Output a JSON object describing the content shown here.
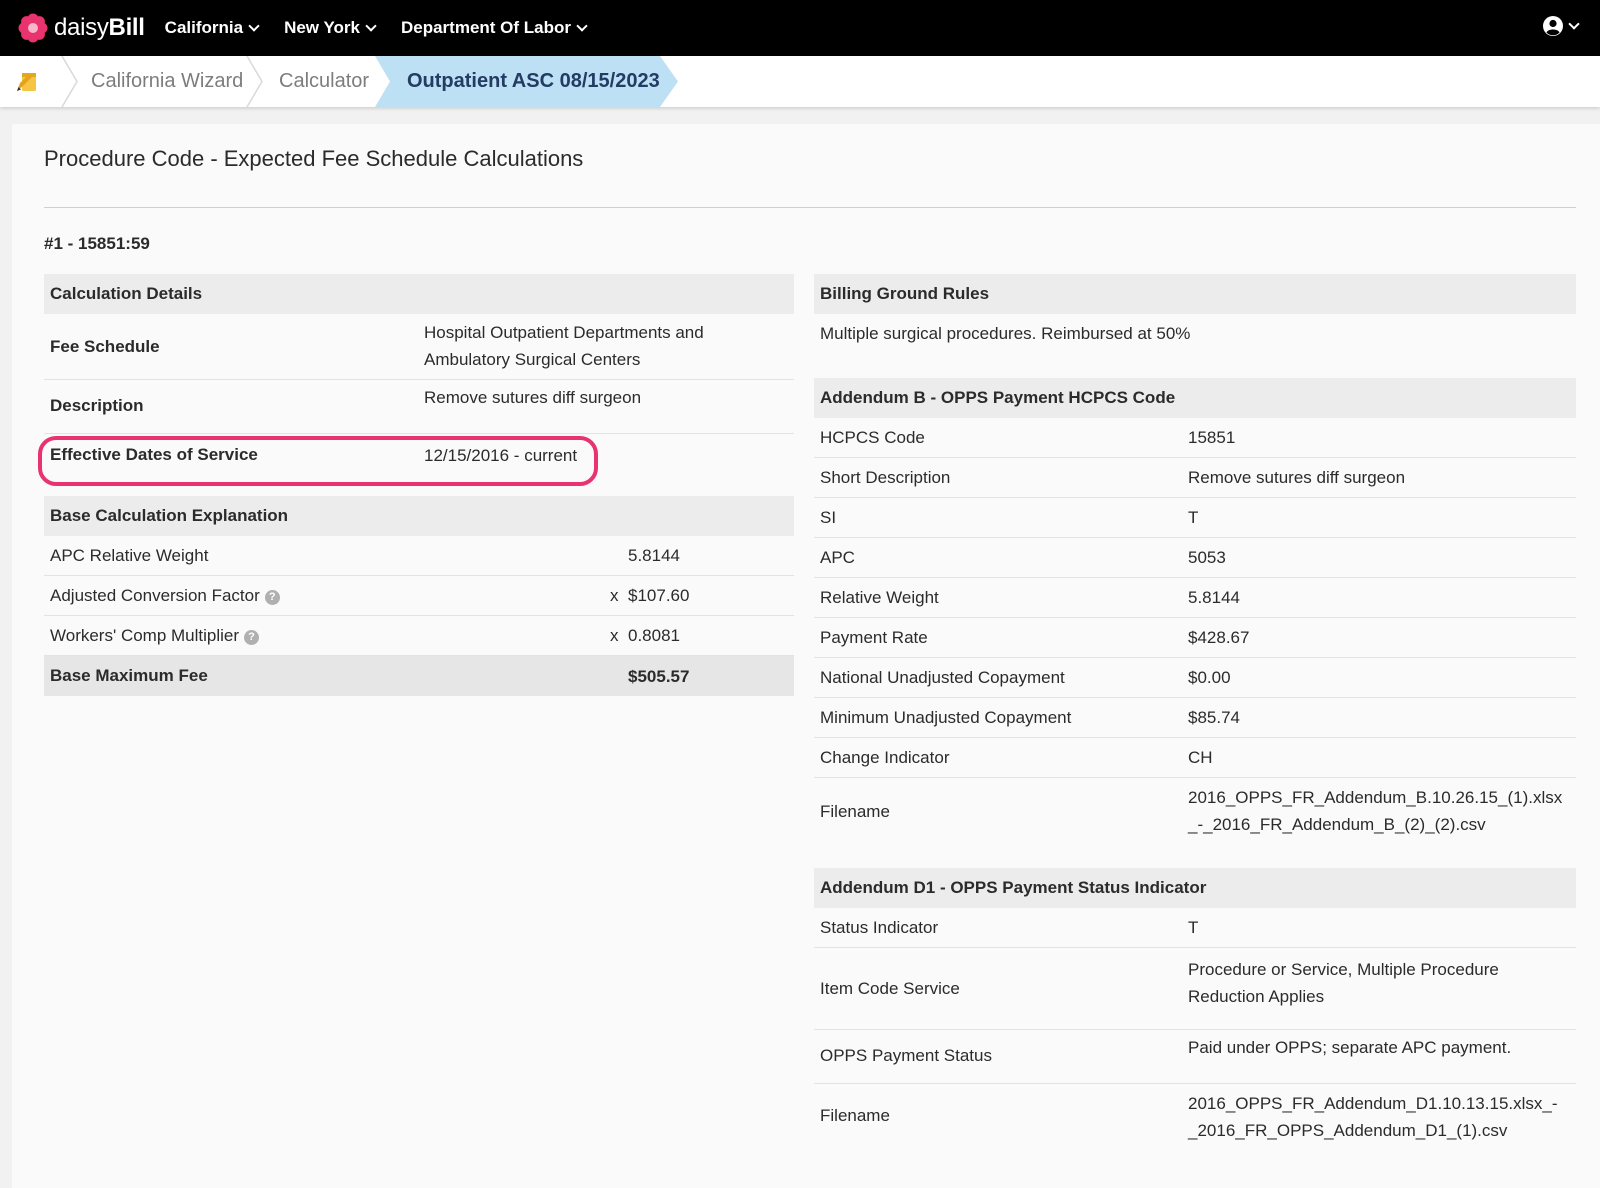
{
  "nav": {
    "brand_light": "daisy",
    "brand_bold": "Bill",
    "links": [
      "California",
      "New York",
      "Department Of Labor"
    ]
  },
  "breadcrumb": {
    "items": [
      "California Wizard",
      "Calculator"
    ],
    "active": "Outpatient ASC 08/15/2023"
  },
  "page": {
    "title": "Procedure Code - Expected Fee Schedule Calculations",
    "code_label": "#1 - 15851:59"
  },
  "calc_details": {
    "header": "Calculation Details",
    "fee_schedule_label": "Fee Schedule",
    "fee_schedule_value_1": "Hospital Outpatient Departments and",
    "fee_schedule_value_2": "Ambulatory Surgical Centers",
    "description_label": "Description",
    "description_value": "Remove sutures diff surgeon",
    "dates_label": "Effective Dates of Service",
    "dates_value": "12/15/2016 - current"
  },
  "base_calc": {
    "header": "Base Calculation Explanation",
    "apc_label": "APC Relative Weight",
    "apc_value": "5.8144",
    "acf_label": "Adjusted Conversion Factor",
    "acf_op": "x",
    "acf_value": "$107.60",
    "wcm_label": "Workers' Comp Multiplier",
    "wcm_op": "x",
    "wcm_value": "0.8081",
    "total_label": "Base Maximum Fee",
    "total_value": "$505.57"
  },
  "ground_rules": {
    "header": "Billing Ground Rules",
    "text": "Multiple surgical procedures. Reimbursed at 50%"
  },
  "addendum_b": {
    "header": "Addendum B - OPPS Payment HCPCS Code",
    "rows": [
      {
        "label": "HCPCS Code",
        "value": "15851"
      },
      {
        "label": "Short Description",
        "value": "Remove sutures diff surgeon"
      },
      {
        "label": "SI",
        "value": "T"
      },
      {
        "label": "APC",
        "value": "5053"
      },
      {
        "label": "Relative Weight",
        "value": "5.8144"
      },
      {
        "label": "Payment Rate",
        "value": "$428.67"
      },
      {
        "label": "National Unadjusted Copayment",
        "value": "$0.00"
      },
      {
        "label": "Minimum Unadjusted Copayment",
        "value": "$85.74"
      },
      {
        "label": "Change Indicator",
        "value": "CH"
      }
    ],
    "filename_label": "Filename",
    "filename_1": "2016_OPPS_FR_Addendum_B.10.26.15_(1).xlsx",
    "filename_2": "_-_2016_FR_Addendum_B_(2)_(2).csv"
  },
  "addendum_d1": {
    "header": "Addendum D1 - OPPS Payment Status Indicator",
    "status_label": "Status Indicator",
    "status_value": "T",
    "item_label": "Item Code Service",
    "item_value_1": "Procedure or Service, Multiple Procedure",
    "item_value_2": "Reduction Applies",
    "opps_label": "OPPS Payment Status",
    "opps_value": "Paid under OPPS; separate APC payment.",
    "filename_label": "Filename",
    "filename_1": "2016_OPPS_FR_Addendum_D1.10.13.15.xlsx_-",
    "filename_2": "_2016_FR_OPPS_Addendum_D1_(1).csv"
  },
  "colors": {
    "nav_bg": "#000000",
    "crumb_active_bg": "#bde0f5",
    "crumb_active_text": "#243b63",
    "highlight": "#e8336e",
    "brand_pink": "#e8336e"
  }
}
